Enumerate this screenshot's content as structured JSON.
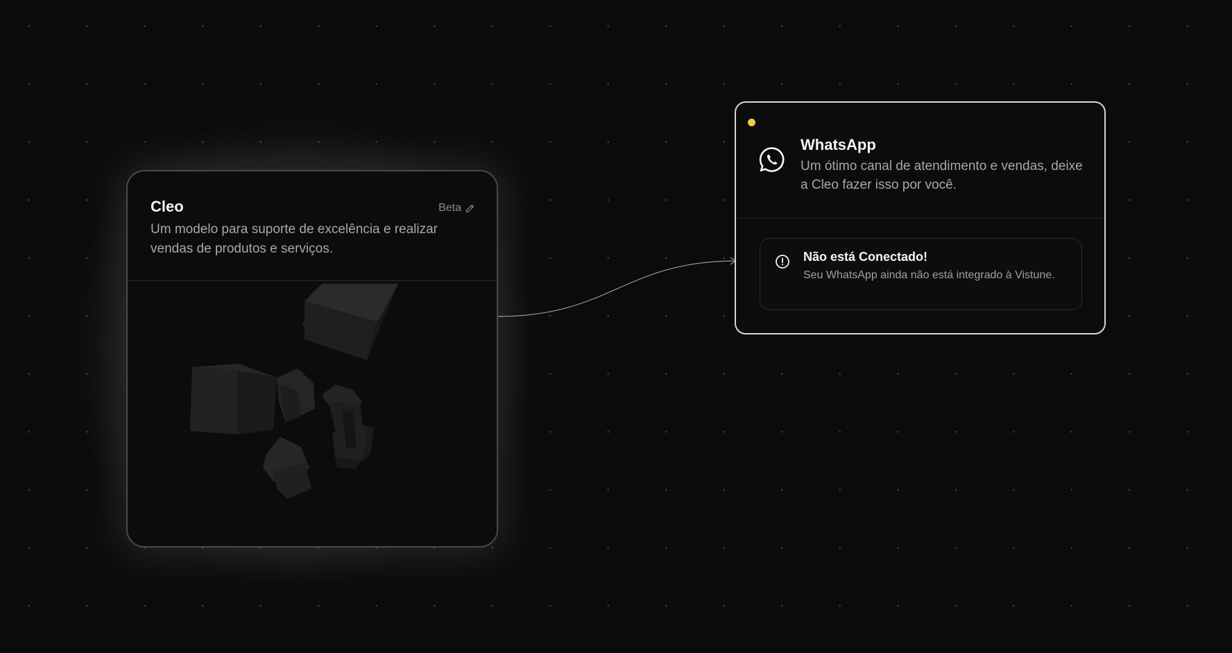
{
  "colors": {
    "background": "#0b0b0b",
    "status_dot": "#f2c94c",
    "connector": "#9a9a9a"
  },
  "cleo_card": {
    "title": "Cleo",
    "badge": "Beta",
    "badge_icon": "pencil-icon",
    "description": "Um modelo para suporte de excelência e realizar vendas de produtos e serviços."
  },
  "whatsapp_card": {
    "icon": "whatsapp-icon",
    "title": "WhatsApp",
    "description": "Um ótimo canal de atendimento e vendas, deixe a Cleo fazer isso por você.",
    "alert": {
      "icon": "alert-circle-icon",
      "title": "Não está Conectado!",
      "description": "Seu WhatsApp ainda não está integrado à Vistune."
    }
  }
}
